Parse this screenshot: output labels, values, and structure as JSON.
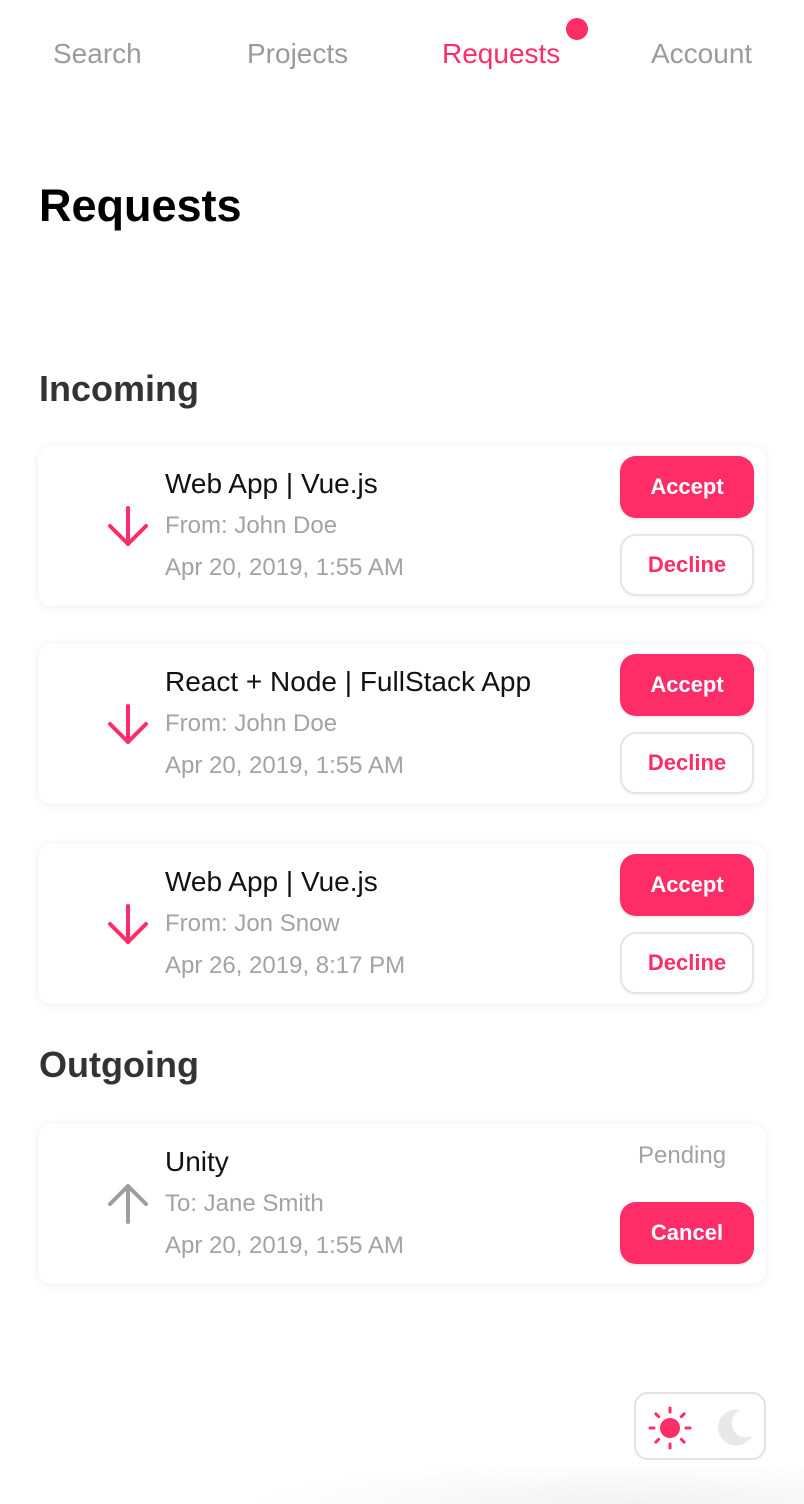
{
  "nav": {
    "items": [
      {
        "label": "Search",
        "active": false
      },
      {
        "label": "Projects",
        "active": false
      },
      {
        "label": "Requests",
        "active": true
      },
      {
        "label": "Account",
        "active": false
      }
    ],
    "notification_dot": true
  },
  "page": {
    "title": "Requests"
  },
  "incoming": {
    "title": "Incoming",
    "items": [
      {
        "title": "Web App | Vue.js",
        "from": "From: John Doe",
        "date": "Apr 20, 2019, 1:55 AM",
        "accept_label": "Accept",
        "decline_label": "Decline",
        "icon": "arrow-down-icon"
      },
      {
        "title": "React + Node | FullStack App",
        "from": "From: John Doe",
        "date": "Apr 20, 2019, 1:55 AM",
        "accept_label": "Accept",
        "decline_label": "Decline",
        "icon": "arrow-down-icon"
      },
      {
        "title": "Web App | Vue.js",
        "from": "From: Jon Snow",
        "date": "Apr 26, 2019, 8:17 PM",
        "accept_label": "Accept",
        "decline_label": "Decline",
        "icon": "arrow-down-icon"
      }
    ]
  },
  "outgoing": {
    "title": "Outgoing",
    "items": [
      {
        "title": "Unity",
        "to": "To: Jane Smith",
        "date": "Apr 20, 2019, 1:55 AM",
        "status": "Pending",
        "cancel_label": "Cancel",
        "icon": "arrow-up-icon"
      }
    ]
  },
  "theme_toggle": {
    "options": [
      "sun-icon",
      "moon-icon"
    ],
    "selected": "light"
  },
  "colors": {
    "accent": "#ff2d67",
    "muted_text": "#a3a3a3",
    "inactive_nav": "#9b9b9b",
    "heading": "#333333"
  }
}
